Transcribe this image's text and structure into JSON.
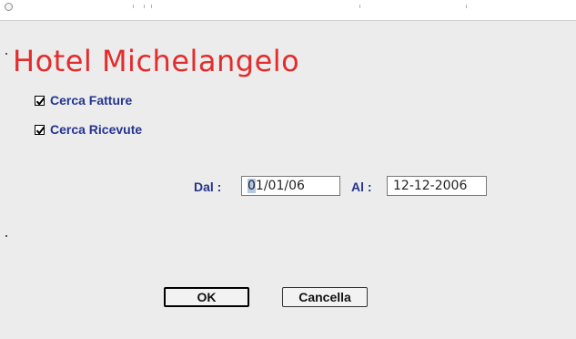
{
  "app": {
    "title": "Hotel Michelangelo"
  },
  "filters": [
    {
      "label": "Cerca Fatture",
      "checked": true
    },
    {
      "label": "Cerca Ricevute",
      "checked": true
    }
  ],
  "date_range": {
    "from_label": "Dal :",
    "from_value_first": "0",
    "from_value_rest": "1/01/06",
    "to_label": "Al :",
    "to_value": "12-12-2006"
  },
  "buttons": {
    "ok_label": "OK",
    "cancel_label": "Cancella"
  },
  "icons": {
    "close": "close-circle-icon",
    "check": "checkmark-icon"
  },
  "colors": {
    "title": "#e32c2c",
    "label": "#24348f",
    "selection": "#b5c8e6"
  }
}
